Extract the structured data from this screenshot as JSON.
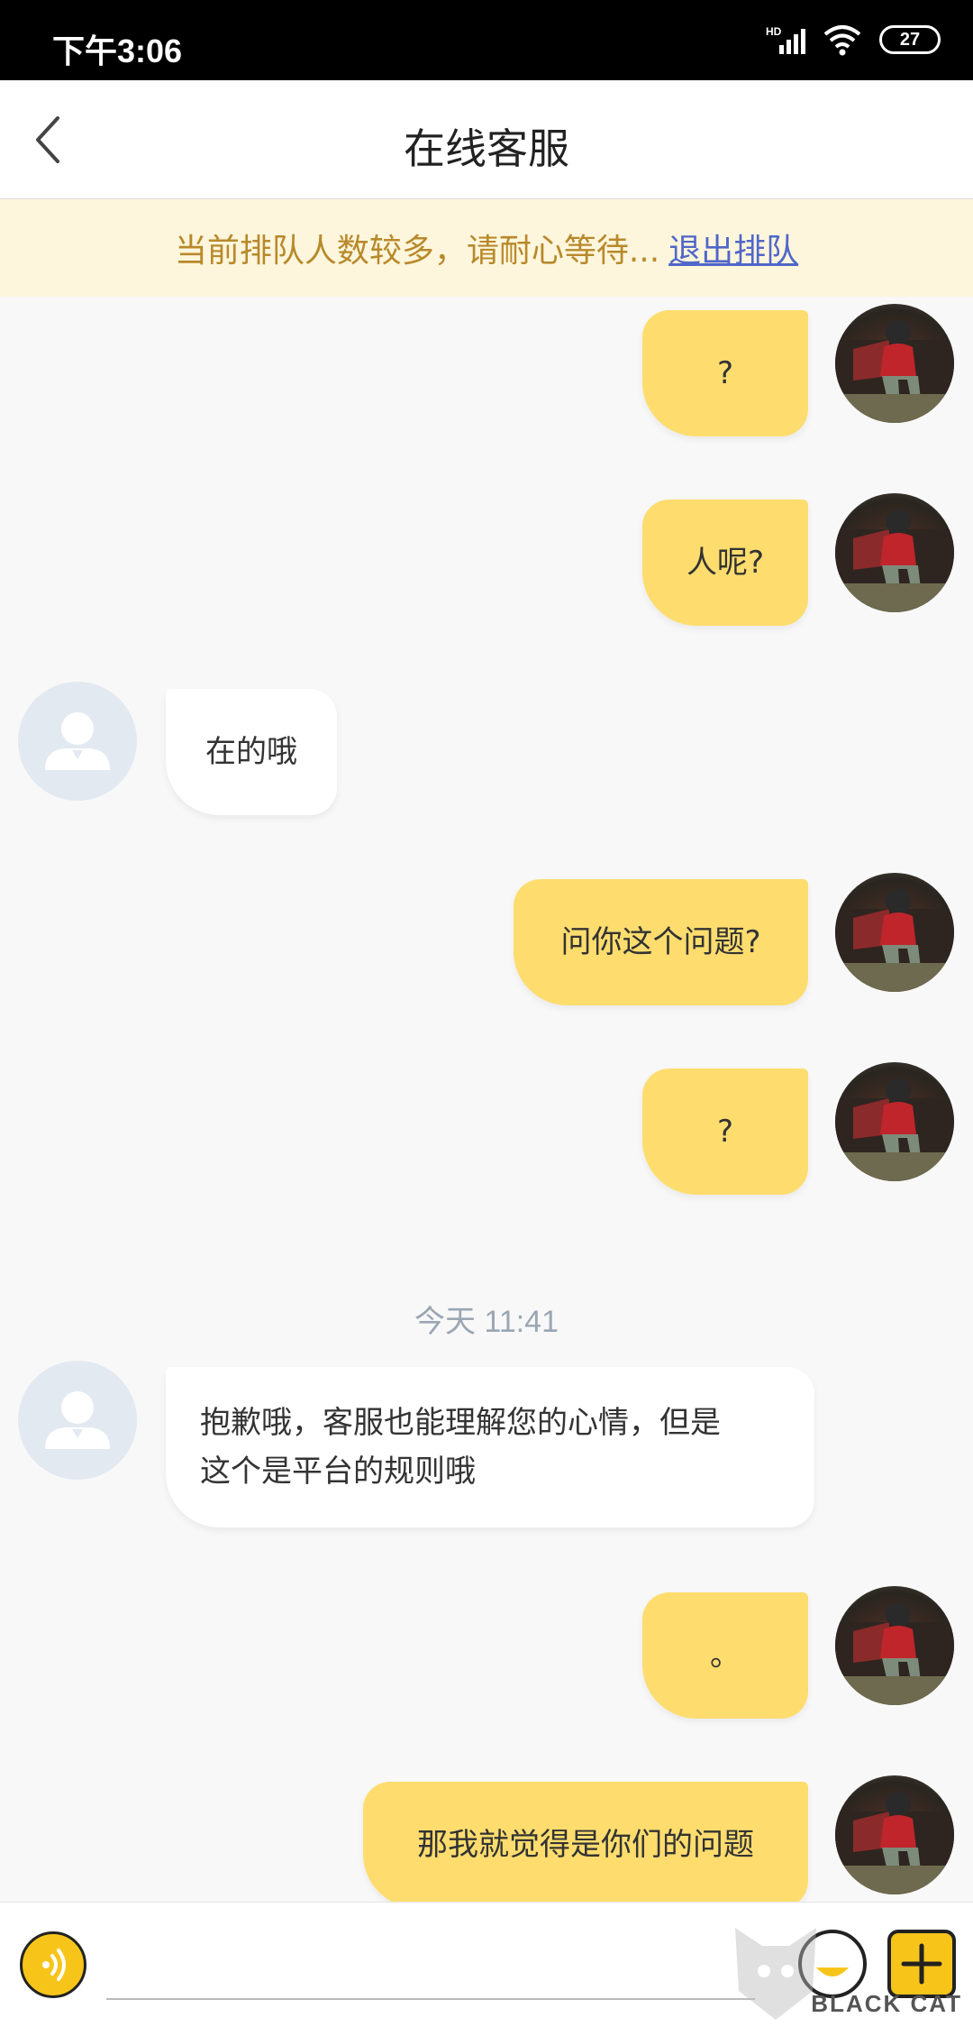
{
  "status_bar": {
    "time": "下午3:06",
    "network_label": "HD",
    "battery": "27"
  },
  "header": {
    "title": "在线客服"
  },
  "queue_banner": {
    "message": "当前排队人数较多，请耐心等待...",
    "exit_link": "退出排队"
  },
  "messages": [
    {
      "sender": "user",
      "text": "?"
    },
    {
      "sender": "user",
      "text": "人呢?"
    },
    {
      "sender": "agent",
      "text": "在的哦"
    },
    {
      "sender": "user",
      "text": "问你这个问题?"
    },
    {
      "sender": "user",
      "text": "?"
    },
    {
      "sender": "agent",
      "text": "抱歉哦，客服也能理解您的心情，但是这个是平台的规则哦",
      "lines": [
        "抱歉哦，客服也能理解您的心情，但是",
        "这个是平台的规则哦"
      ]
    },
    {
      "sender": "user",
      "text": "。"
    },
    {
      "sender": "user",
      "text": "那我就觉得是你们的问题"
    }
  ],
  "timestamp": "今天 11:41",
  "input": {
    "placeholder": ""
  },
  "watermark": {
    "text": "BLACK CAT"
  },
  "colors": {
    "user_bubble": "#fedd6e",
    "agent_bubble": "#ffffff",
    "banner_bg": "#fdf6dc",
    "banner_text": "#b8892b",
    "link": "#5067c9"
  }
}
